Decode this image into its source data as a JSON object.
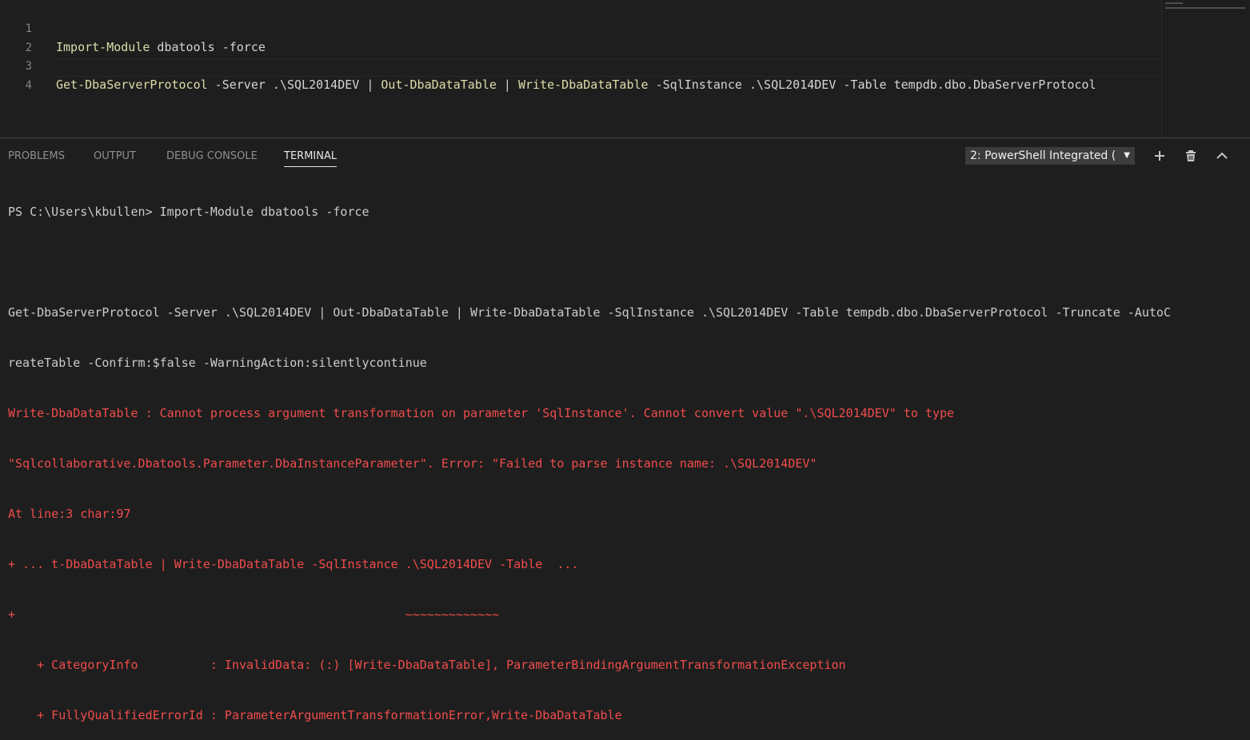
{
  "editor": {
    "lines": [
      {
        "num": "1",
        "cmd": "Import-Module",
        "rest": " dbatools -force"
      },
      {
        "num": "2",
        "cmd": "",
        "rest": ""
      },
      {
        "num": "3",
        "cmd": "Get-DbaServerProtocol",
        "rest": " -Server .\\SQL2014DEV | ",
        "cmd2": "Out-DbaDataTable",
        "rest2": " | ",
        "cmd3": "Write-DbaDataTable",
        "rest3": " -SqlInstance .\\SQL2014DEV -Table tempdb.dbo.DbaServerProtocol"
      },
      {
        "num": "4",
        "cmd": "",
        "rest": ""
      }
    ]
  },
  "panel": {
    "tabs": {
      "problems": "PROBLEMS",
      "output": "OUTPUT",
      "debug_console": "DEBUG CONSOLE",
      "terminal": "TERMINAL"
    },
    "terminal_select": "2: PowerShell Integrated (",
    "icons": {
      "add": "plus-icon",
      "trash": "trash-icon",
      "maximize": "chevron-up-icon"
    }
  },
  "terminal": {
    "lines": [
      {
        "text": "PS C:\\Users\\kbullen> Import-Module dbatools -force",
        "style": "normal"
      },
      {
        "text": "",
        "style": "normal"
      },
      {
        "text": "Get-DbaServerProtocol -Server .\\SQL2014DEV | Out-DbaDataTable | Write-DbaDataTable -SqlInstance .\\SQL2014DEV -Table tempdb.dbo.DbaServerProtocol -Truncate -AutoC",
        "style": "normal"
      },
      {
        "text": "reateTable -Confirm:$false -WarningAction:silentlycontinue",
        "style": "normal"
      },
      {
        "text": "Write-DbaDataTable : Cannot process argument transformation on parameter 'SqlInstance'. Cannot convert value \".\\SQL2014DEV\" to type",
        "style": "err"
      },
      {
        "text": "\"Sqlcollaborative.Dbatools.Parameter.DbaInstanceParameter\". Error: \"Failed to parse instance name: .\\SQL2014DEV\"",
        "style": "err"
      },
      {
        "text": "At line:3 char:97",
        "style": "err"
      },
      {
        "text": "+ ... t-DbaDataTable | Write-DbaDataTable -SqlInstance .\\SQL2014DEV -Table  ...",
        "style": "err"
      },
      {
        "text": "+                                                      ~~~~~~~~~~~~~",
        "style": "err"
      },
      {
        "text": "    + CategoryInfo          : InvalidData: (:) [Write-DbaDataTable], ParameterBindingArgumentTransformationException",
        "style": "err"
      },
      {
        "text": "    + FullyQualifiedErrorId : ParameterArgumentTransformationError,Write-DbaDataTable",
        "style": "err"
      }
    ]
  }
}
